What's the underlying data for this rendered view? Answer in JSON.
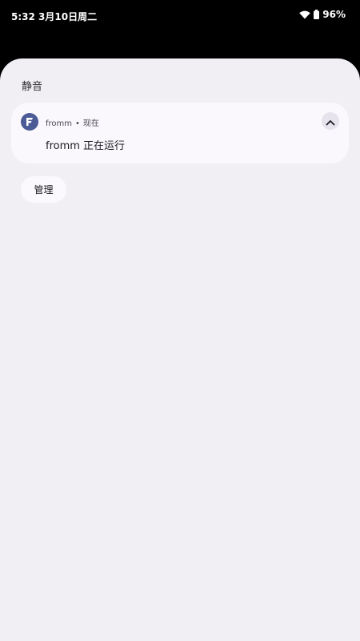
{
  "status_bar": {
    "time": "5:32",
    "date": "3月10日周二",
    "battery_percent": "96%",
    "icons": [
      "wifi-icon",
      "battery-icon"
    ]
  },
  "shade": {
    "section_title": "静音",
    "notification": {
      "app_name": "fromm",
      "separator": "•",
      "time": "现在",
      "text": "fromm 正在运行",
      "app_icon": "fromm-app-icon",
      "expand_icon": "chevron-up-icon"
    },
    "manage_label": "管理"
  },
  "colors": {
    "shade_bg": "#f1eff4",
    "card_bg": "#faf8fd",
    "app_icon_bg": "#4b5b96"
  }
}
